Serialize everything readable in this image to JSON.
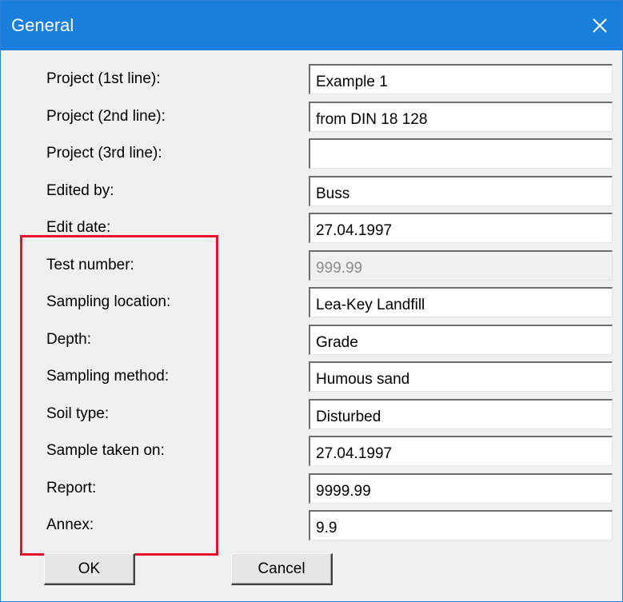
{
  "window": {
    "title": "General",
    "close_icon": "close-icon"
  },
  "rows": [
    {
      "label": "Project (1st line):",
      "value": "Example 1",
      "disabled": false
    },
    {
      "label": "Project (2nd line):",
      "value": "from DIN 18 128",
      "disabled": false
    },
    {
      "label": "Project (3rd line):",
      "value": "",
      "disabled": false
    },
    {
      "label": "Edited by:",
      "value": "Buss",
      "disabled": false
    },
    {
      "label": "Edit date:",
      "value": "27.04.1997",
      "disabled": false
    },
    {
      "label": "Test number:",
      "value": "999.99",
      "disabled": true
    },
    {
      "label": "Sampling location:",
      "value": "Lea-Key Landfill",
      "disabled": false
    },
    {
      "label": "Depth:",
      "value": "Grade",
      "disabled": false
    },
    {
      "label": "Sampling method:",
      "value": "Humous sand",
      "disabled": false
    },
    {
      "label": "Soil type:",
      "value": "Disturbed",
      "disabled": false
    },
    {
      "label": "Sample taken on:",
      "value": "27.04.1997",
      "disabled": false
    },
    {
      "label": "Report:",
      "value": "9999.99",
      "disabled": false
    },
    {
      "label": "Annex:",
      "value": "9.9",
      "disabled": false
    }
  ],
  "buttons": {
    "ok": "OK",
    "cancel": "Cancel"
  },
  "colors": {
    "titlebar": "#1a7fdc",
    "highlight": "#e8102a",
    "dialog_bg": "#f0f0f0"
  }
}
